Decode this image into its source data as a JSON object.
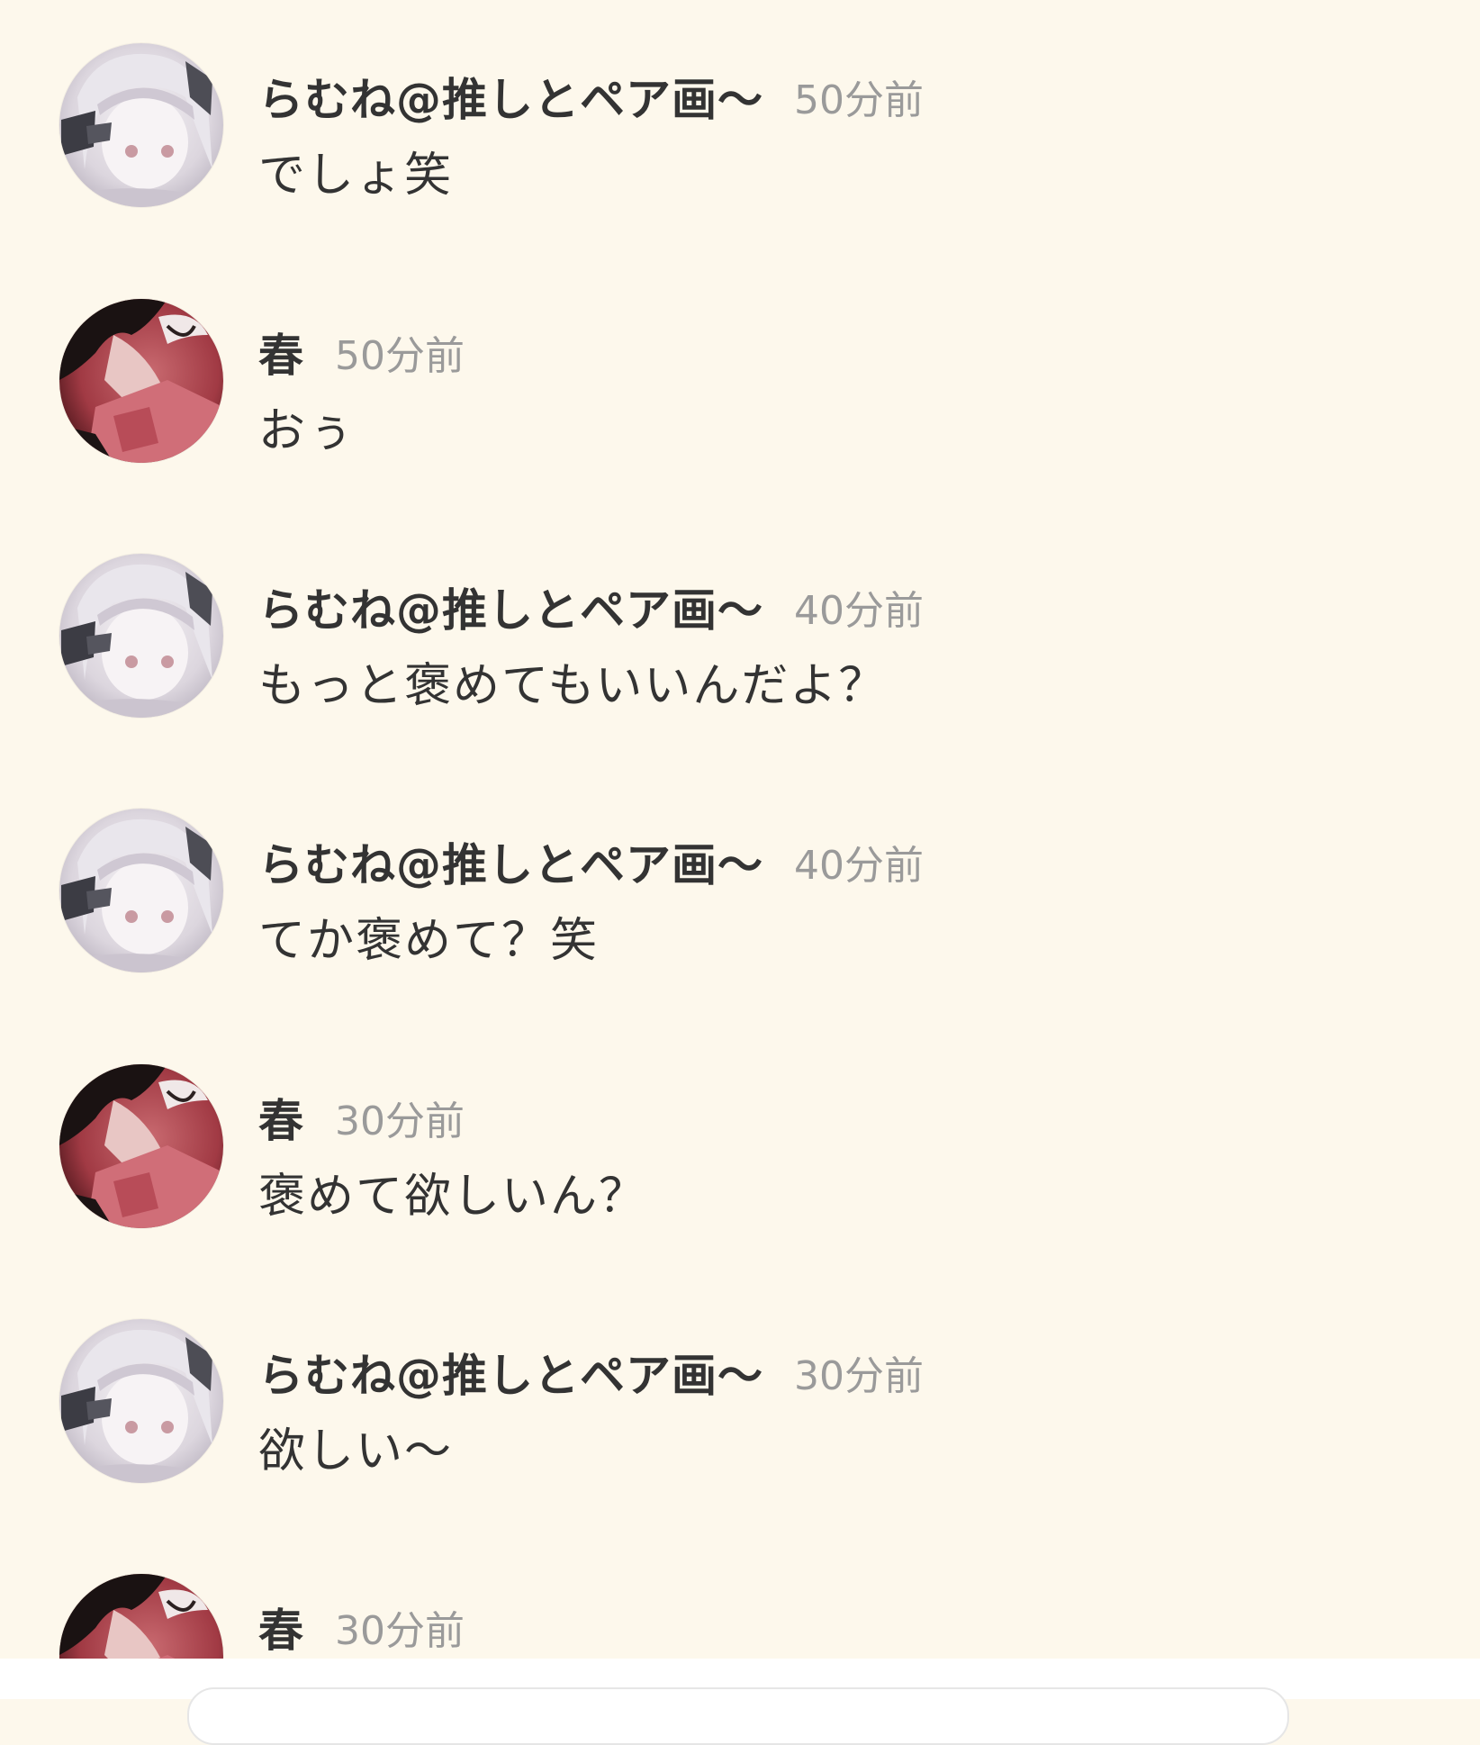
{
  "messages": [
    {
      "user": "らむね@推しとペア画〜",
      "time": "50分前",
      "text": "でしょ笑",
      "avatar": "user-a"
    },
    {
      "user": "春",
      "time": "50分前",
      "text": "おぅ",
      "avatar": "user-b"
    },
    {
      "user": "らむね@推しとペア画〜",
      "time": "40分前",
      "text": "もっと褒めてもいいんだよ？",
      "avatar": "user-a"
    },
    {
      "user": "らむね@推しとペア画〜",
      "time": "40分前",
      "text": "てか褒めて？笑",
      "avatar": "user-a"
    },
    {
      "user": "春",
      "time": "30分前",
      "text": "褒めて欲しいん？",
      "avatar": "user-b"
    },
    {
      "user": "らむね@推しとペア画〜",
      "time": "30分前",
      "text": "欲しい〜",
      "avatar": "user-a"
    },
    {
      "user": "春",
      "time": "30分前",
      "text": "",
      "avatar": "user-b"
    }
  ],
  "colors": {
    "background": "#fdf8ec",
    "username": "#333333",
    "time": "#9a9a9a"
  }
}
